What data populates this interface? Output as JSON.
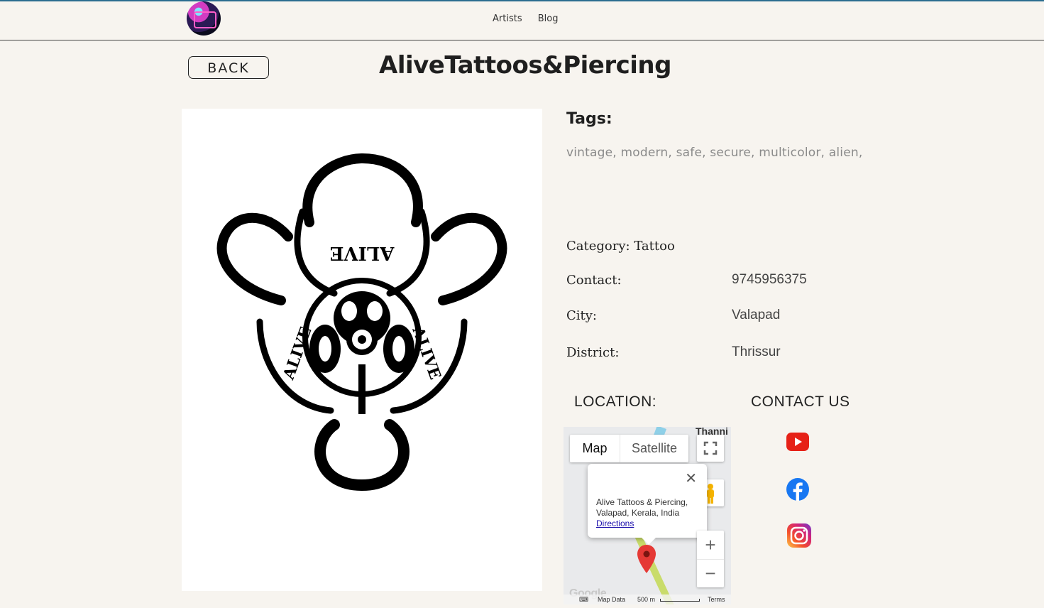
{
  "header": {
    "nav": [
      "Artists",
      "Blog"
    ]
  },
  "page": {
    "back_label": "BACK",
    "title": "AliveTattoos&Piercing"
  },
  "tags": {
    "heading": "Tags:",
    "text": "vintage, modern, safe, secure, multicolor, alien,"
  },
  "details": {
    "category_label": "Category:",
    "category_value": "Tattoo",
    "contact_label": "Contact:",
    "contact_value": "9745956375",
    "city_label": "City:",
    "city_value": "Valapad",
    "district_label": "District:",
    "district_value": "Thrissur"
  },
  "location": {
    "heading": "LOCATION:",
    "map_tab": "Map",
    "satellite_tab": "Satellite",
    "place_label": "Thanni",
    "info_address": "Alive Tattoos & Piercing, Valapad, Kerala, India",
    "directions_label": "Directions",
    "zoom_in": "+",
    "zoom_out": "−",
    "google_logo": "Google",
    "map_data": "Map Data",
    "scale": "500 m",
    "terms": "Terms"
  },
  "contact_us": {
    "heading": "CONTACT US",
    "icons": [
      "youtube-icon",
      "facebook-icon",
      "instagram-icon"
    ]
  },
  "colors": {
    "background": "#f7f4ef",
    "youtube": "#e62117",
    "facebook": "#1877f2",
    "map_pin": "#e53935"
  }
}
